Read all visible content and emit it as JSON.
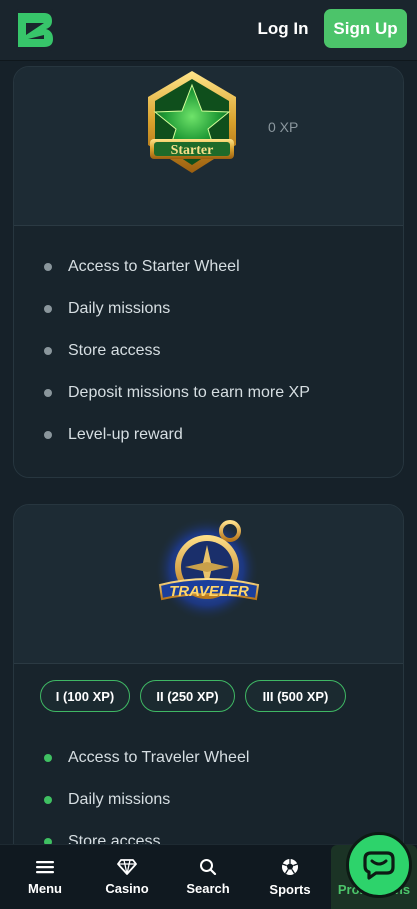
{
  "header": {
    "logo_icon": "brand-logo-icon",
    "login_label": "Log In",
    "signup_label": "Sign Up",
    "accent_color": "#4cc46a"
  },
  "levels": [
    {
      "badge_icon": "starter-star-badge-icon",
      "badge_text": "Starter",
      "xp": "0 XP",
      "perks": [
        "Access to Starter Wheel",
        "Daily missions",
        "Store access",
        "Deposit missions to earn more XP",
        "Level-up reward"
      ]
    },
    {
      "badge_icon": "traveler-compass-badge-icon",
      "badge_text": "TRAVELER",
      "tiers": [
        "I (100 XP)",
        "II (250 XP)",
        "III (500 XP)"
      ],
      "perks": [
        "Access to Traveler Wheel",
        "Daily missions",
        "Store access"
      ]
    }
  ],
  "bottom_nav": {
    "items": [
      {
        "label": "Menu",
        "icon": "menu-icon"
      },
      {
        "label": "Casino",
        "icon": "diamond-icon"
      },
      {
        "label": "Search",
        "icon": "search-icon"
      },
      {
        "label": "Sports",
        "icon": "ball-icon"
      },
      {
        "label": "Promotions",
        "icon": "gift-icon"
      }
    ],
    "chat_icon": "chat-icon"
  }
}
